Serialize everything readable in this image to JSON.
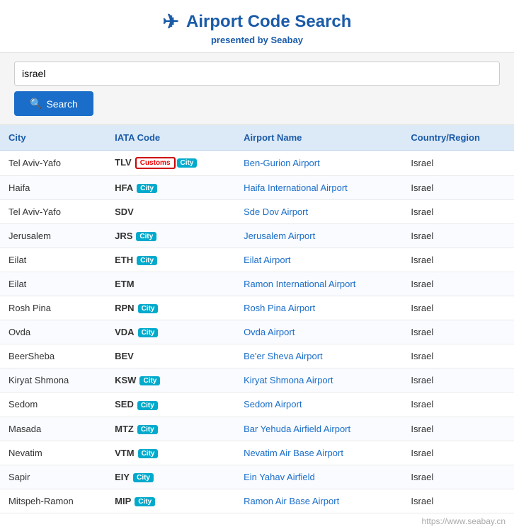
{
  "header": {
    "title": "Airport Code Search",
    "subtitle": "presented by",
    "brand": "Seabay",
    "icon": "✈"
  },
  "search": {
    "placeholder": "israel",
    "value": "israel",
    "button_label": "Search"
  },
  "table": {
    "columns": [
      "City",
      "IATA Code",
      "Airport Name",
      "Country/Region"
    ],
    "rows": [
      {
        "city": "Tel Aviv-Yafo",
        "iata": "TLV",
        "badges": [
          "customs",
          "city"
        ],
        "airport_name": "Ben-Gurion Airport",
        "country": "Israel"
      },
      {
        "city": "Haifa",
        "iata": "HFA",
        "badges": [
          "city"
        ],
        "airport_name": "Haifa International Airport",
        "country": "Israel"
      },
      {
        "city": "Tel Aviv-Yafo",
        "iata": "SDV",
        "badges": [],
        "airport_name": "Sde Dov Airport",
        "country": "Israel"
      },
      {
        "city": "Jerusalem",
        "iata": "JRS",
        "badges": [
          "city"
        ],
        "airport_name": "Jerusalem Airport",
        "country": "Israel"
      },
      {
        "city": "Eilat",
        "iata": "ETH",
        "badges": [
          "city"
        ],
        "airport_name": "Eilat Airport",
        "country": "Israel"
      },
      {
        "city": "Eilat",
        "iata": "ETM",
        "badges": [],
        "airport_name": "Ramon International Airport",
        "country": "Israel"
      },
      {
        "city": "Rosh Pina",
        "iata": "RPN",
        "badges": [
          "city"
        ],
        "airport_name": "Rosh Pina Airport",
        "country": "Israel"
      },
      {
        "city": "Ovda",
        "iata": "VDA",
        "badges": [
          "city"
        ],
        "airport_name": "Ovda Airport",
        "country": "Israel"
      },
      {
        "city": "BeerSheba",
        "iata": "BEV",
        "badges": [],
        "airport_name": "Be'er Sheva Airport",
        "country": "Israel"
      },
      {
        "city": "Kiryat Shmona",
        "iata": "KSW",
        "badges": [
          "city"
        ],
        "airport_name": "Kiryat Shmona Airport",
        "country": "Israel"
      },
      {
        "city": "Sedom",
        "iata": "SED",
        "badges": [
          "city"
        ],
        "airport_name": "Sedom Airport",
        "country": "Israel"
      },
      {
        "city": "Masada",
        "iata": "MTZ",
        "badges": [
          "city"
        ],
        "airport_name": "Bar Yehuda Airfield Airport",
        "country": "Israel"
      },
      {
        "city": "Nevatim",
        "iata": "VTM",
        "badges": [
          "city"
        ],
        "airport_name": "Nevatim Air Base Airport",
        "country": "Israel"
      },
      {
        "city": "Sapir",
        "iata": "EIY",
        "badges": [
          "city"
        ],
        "airport_name": "Ein Yahav Airfield",
        "country": "Israel"
      },
      {
        "city": "Mitspeh-Ramon",
        "iata": "MIP",
        "badges": [
          "city"
        ],
        "airport_name": "Ramon Air Base Airport",
        "country": "Israel"
      }
    ]
  },
  "badges": {
    "customs_label": "Customs",
    "city_label": "City"
  },
  "watermark": "https://www.seabay.cn"
}
